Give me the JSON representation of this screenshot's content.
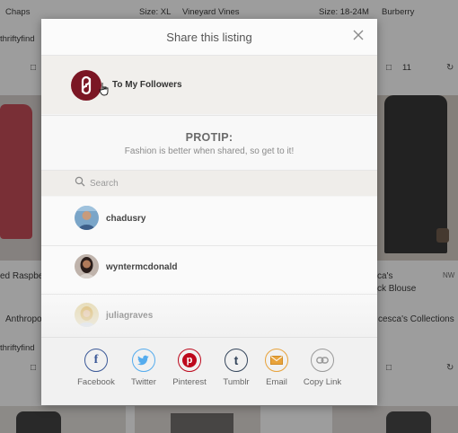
{
  "background": {
    "top_texts": [
      "Chaps",
      "Size: XL",
      "Vineyard Vines",
      "Size: 18-24M",
      "Burberry"
    ],
    "handle_left": "thriftyfind",
    "handle_left2": "thriftyfind",
    "comment_count": "11",
    "left_title": "ed Raspbe",
    "left_brand": "Anthropo",
    "right_title_1": "ca's",
    "right_title_2": "ck Blouse",
    "right_brand": "cesca's Collections",
    "nwt_badge": "NW"
  },
  "modal": {
    "title": "Share this listing",
    "close_icon": "close-icon",
    "followers_label": "To My Followers",
    "protip_title": "PROTIP:",
    "protip_text": "Fashion is better when shared, so get to it!",
    "search_placeholder": "Search",
    "users": [
      {
        "name": "chadusry"
      },
      {
        "name": "wyntermcdonald"
      },
      {
        "name": "juliagraves"
      }
    ],
    "share_options": [
      {
        "label": "Facebook",
        "icon": "facebook-icon",
        "color": "#3b5998"
      },
      {
        "label": "Twitter",
        "icon": "twitter-icon",
        "color": "#55acee"
      },
      {
        "label": "Pinterest",
        "icon": "pinterest-icon",
        "color": "#bd081c"
      },
      {
        "label": "Tumblr",
        "icon": "tumblr-icon",
        "color": "#35465c"
      },
      {
        "label": "Email",
        "icon": "email-icon",
        "color": "#e8a33c"
      },
      {
        "label": "Copy Link",
        "icon": "link-icon",
        "color": "#9a9a9a"
      }
    ]
  },
  "colors": {
    "brand_maroon": "#7b1624"
  }
}
